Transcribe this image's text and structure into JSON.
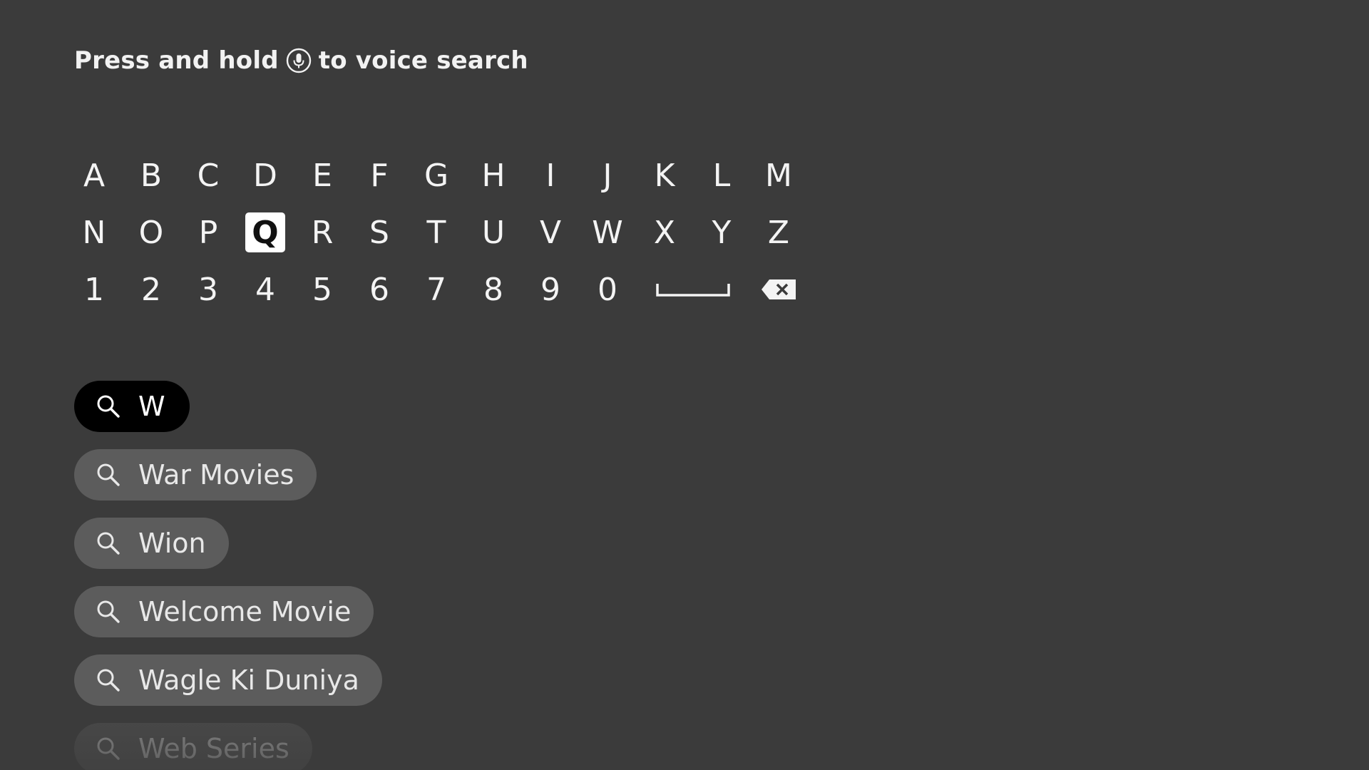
{
  "header": {
    "hint_before": "Press and hold",
    "hint_icon": "microphone-icon",
    "hint_after": "to voice search"
  },
  "keyboard": {
    "rows": [
      [
        "A",
        "B",
        "C",
        "D",
        "E",
        "F",
        "G",
        "H",
        "I",
        "J",
        "K",
        "L",
        "M"
      ],
      [
        "N",
        "O",
        "P",
        "Q",
        "R",
        "S",
        "T",
        "U",
        "V",
        "W",
        "X",
        "Y",
        "Z"
      ],
      [
        "1",
        "2",
        "3",
        "4",
        "5",
        "6",
        "7",
        "8",
        "9",
        "0"
      ]
    ],
    "selected_key": "Q",
    "space_icon": "space-bar-icon",
    "backspace_icon": "backspace-icon"
  },
  "search": {
    "query": "W",
    "icon": "search-icon"
  },
  "suggestions": [
    "War Movies",
    "Wion",
    "Welcome Movie",
    "Wagle Ki Duniya",
    "Web Series"
  ],
  "colors": {
    "background": "#3b3b3b",
    "pill": "#5c5c5c",
    "query_pill": "#000000",
    "selected_key_bg": "#ffffff"
  }
}
